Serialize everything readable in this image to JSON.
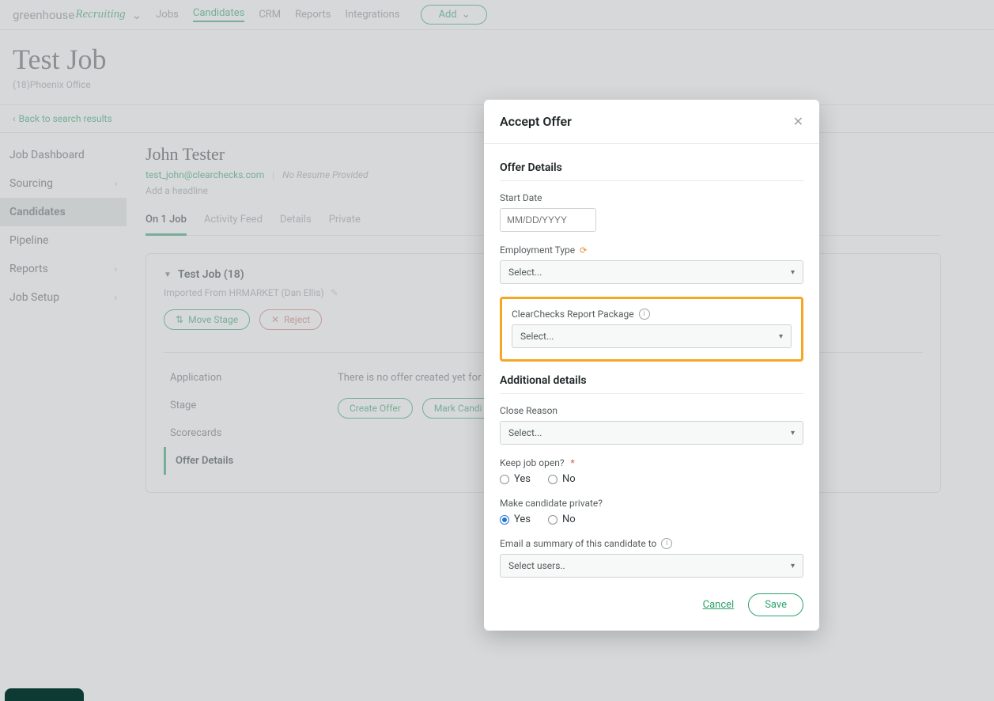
{
  "brand": {
    "name": "greenhouse",
    "product": "Recruiting"
  },
  "topnav": {
    "jobs": "Jobs",
    "candidates": "Candidates",
    "crm": "CRM",
    "reports": "Reports",
    "integrations": "Integrations",
    "add": "Add"
  },
  "page": {
    "title": "Test Job",
    "subtitle": "(18)Phoenix Office",
    "back": "Back to search results"
  },
  "sidebar": {
    "job_dashboard": "Job Dashboard",
    "sourcing": "Sourcing",
    "candidates": "Candidates",
    "pipeline": "Pipeline",
    "reports": "Reports",
    "job_setup": "Job Setup"
  },
  "candidate": {
    "name": "John Tester",
    "email": "test_john@clearchecks.com",
    "resume": "No Resume Provided",
    "add_headline": "Add a headline"
  },
  "tabs": {
    "on1job": "On 1 Job",
    "activity_feed": "Activity Feed",
    "details": "Details",
    "private": "Private"
  },
  "job_card": {
    "title": "Test Job (18)",
    "imported": "Imported From HRMARKET (Dan Ellis)",
    "move_stage": "Move Stage",
    "reject": "Reject"
  },
  "subnav": {
    "application": "Application",
    "stage": "Stage",
    "scorecards": "Scorecards",
    "offer_details": "Offer Details"
  },
  "offer_area": {
    "no_offer": "There is no offer created yet for th",
    "create_offer": "Create Offer",
    "mark_candidate": "Mark Candi"
  },
  "modal": {
    "title": "Accept Offer",
    "section_offer": "Offer Details",
    "start_date_label": "Start Date",
    "start_date_placeholder": "MM/DD/YYYY",
    "employment_type_label": "Employment Type",
    "select_placeholder": "Select...",
    "cc_label": "ClearChecks Report Package",
    "section_additional": "Additional details",
    "close_reason_label": "Close Reason",
    "keep_job_open_label": "Keep job open?",
    "yes": "Yes",
    "no": "No",
    "make_private_label": "Make candidate private?",
    "email_summary_label": "Email a summary of this candidate to",
    "select_users_placeholder": "Select users..",
    "cancel": "Cancel",
    "save": "Save"
  }
}
